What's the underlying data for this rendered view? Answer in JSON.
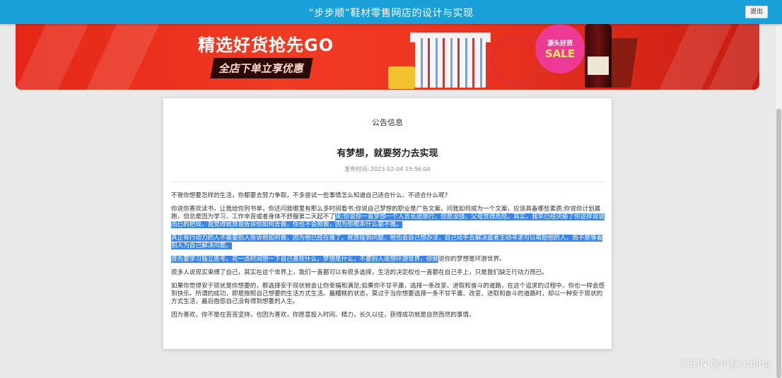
{
  "header": {
    "title": "“步步顺”鞋材零售网店的设计与实现",
    "logout_label": "退出"
  },
  "banner": {
    "headline": "精选好货抢先GO",
    "promo": "全店下单立享优惠",
    "badge_top": "源头好货",
    "badge_main": "SALE"
  },
  "notice": {
    "section_title": "公告信息",
    "article_title": "有梦想，就要努力去实现",
    "published_label": "发布时间:",
    "published_value": "2023-02-04 15:56:04",
    "paragraphs": [
      {
        "plain": "不管你想要怎样的生活，你都要去努力争取，不多尝试一些事情怎么知道自己适合什么、不适合什么呢?"
      },
      {
        "plain": "你说你喜欢读书，让我给你列书单，你还问我哪里有那么多时间看书;你说自己梦想的职业是广告文案，问我如何成为一个文案，应该具备哪些素质;你说你计划晨跑，但总是因为学习、工作辛苦或者身体不舒服第二天起不了",
        "highlight": "床;你说你一直梦想一个人去长途旅行，但是没钱，父母觉得危险。其实，我早已经厌倦了你这样说说而已的把戏，我觉得就算我告诉你如何去做，你也不会照做，因为你根本什么都不做。"
      },
      {
        "highlight": "真正有行动力的人不需要别人告诉他如何做，因为他已经在做了。就算碰到问题，他也会自己想办法，自己动手去解决或者主动寻求可以帮助他的人，而不是等着别人为自己解决问题。"
      },
      {
        "highlight": "首先要学习独立思考。花一点时间想一下自己喜欢什么，梦想是什么，不要别人说想环游世界，你就",
        "plain_after": "说你的梦想是环游世界。"
      },
      {
        "plain": "很多人说现实束缚了自己，其实在这个世界上，我们一直都可以有很多选择，生活的决定权也一直都在自己手上，只是我们缺乏行动力而已。"
      },
      {
        "plain": "如果你觉得安于现状是你想要的，那选择安于现状就会让你幸福和满足;如果你不甘平庸，选择一条改变、进取和奋斗的道路，在这个追求的过程中，你也一样会感到快乐。所谓的成功，即是按照自己想要的生活方式生活。最糟糕的状态，莫过于当你想要选择一条不甘平庸、改变、进取和奋斗的道路时，却以一种安于现状的方式生活，最后抱怨自己没有得到想要的人生。"
      },
      {
        "plain": "因为喜欢，你不是在苦苦坚持，也因为喜欢，你愿意投入时间、精力，长久以往，获得成功就是自然而然的事情。"
      }
    ]
  },
  "watermark": "CSDN @小蔡coding",
  "colors": {
    "header_bg": "#1aa0d8",
    "selection": "#3a86e8",
    "banner_red": "#e52618"
  }
}
